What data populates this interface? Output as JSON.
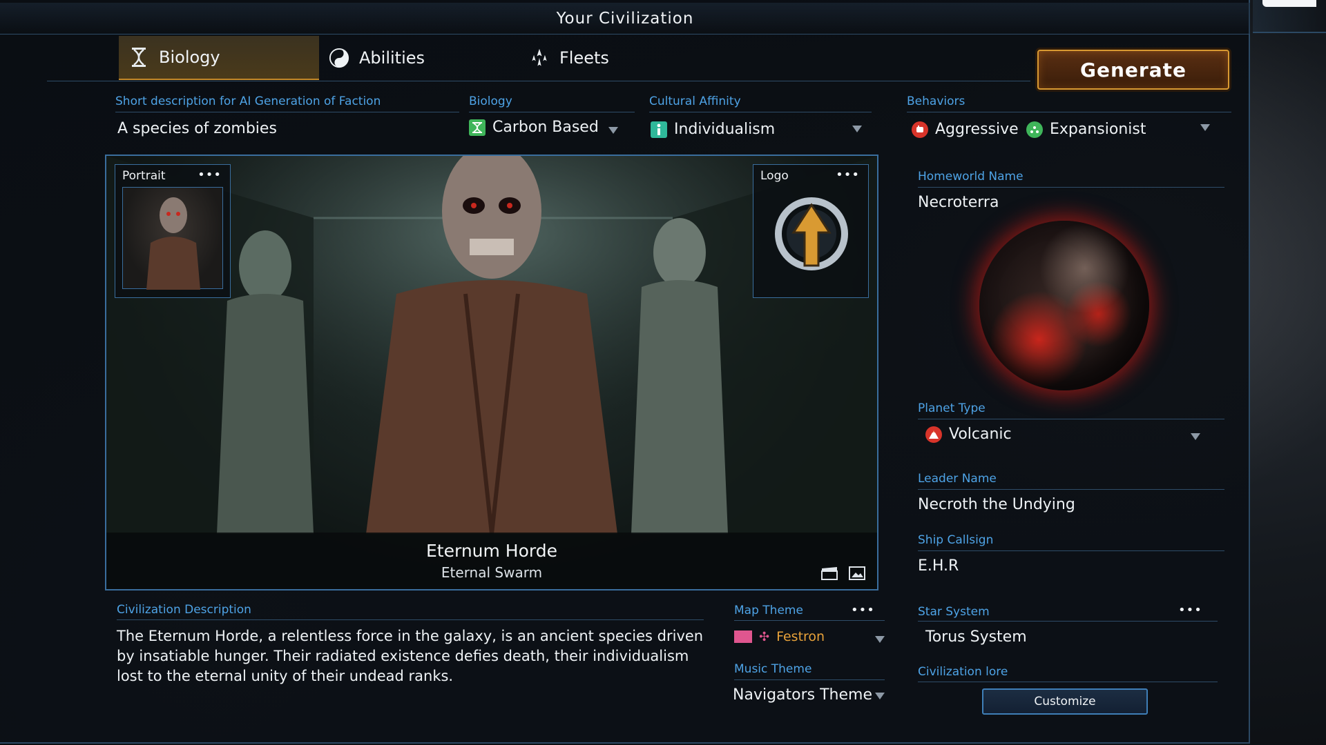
{
  "window": {
    "title": "Your Civilization"
  },
  "tabs": [
    {
      "label": "Biology",
      "icon": "dna-icon",
      "active": true
    },
    {
      "label": "Abilities",
      "icon": "yin-yang-icon",
      "active": false
    },
    {
      "label": "Fleets",
      "icon": "fleet-icon",
      "active": false
    }
  ],
  "generate": {
    "label": "Generate"
  },
  "description_field": {
    "label": "Short description for AI Generation of Faction",
    "value": "A species of zombies"
  },
  "biology": {
    "label": "Biology",
    "value": "Carbon Based",
    "color": "#3fb55a"
  },
  "cultural_affinity": {
    "label": "Cultural Affinity",
    "value": "Individualism",
    "color": "#2fb89a"
  },
  "behaviors": {
    "label": "Behaviors",
    "items": [
      {
        "label": "Aggressive",
        "color": "#d8342a"
      },
      {
        "label": "Expansionist",
        "color": "#3fb55a"
      }
    ]
  },
  "portrait": {
    "label": "Portrait",
    "menu": "•••"
  },
  "logo": {
    "label": "Logo",
    "menu": "•••"
  },
  "faction": {
    "name": "Eternum Horde",
    "subtitle": "Eternal Swarm"
  },
  "homeworld": {
    "label": "Homeworld Name",
    "value": "Necroterra"
  },
  "planet_type": {
    "label": "Planet Type",
    "value": "Volcanic",
    "color": "#d8342a"
  },
  "leader": {
    "label": "Leader Name",
    "value": "Necroth the Undying"
  },
  "ship_callsign": {
    "label": "Ship Callsign",
    "value": "E.H.R"
  },
  "civ_description": {
    "label": "Civilization Description",
    "value": "The Eternum Horde, a relentless force in the galaxy, is an ancient species driven by insatiable hunger. Their radiated existence defies death, their individualism lost to the eternal unity of their undead ranks."
  },
  "map_theme": {
    "label": "Map Theme",
    "value": "Festron",
    "menu": "•••",
    "color": "#e0568f",
    "value_color": "#e8a23a"
  },
  "music_theme": {
    "label": "Music Theme",
    "value": "Navigators Theme"
  },
  "star_system": {
    "label": "Star System",
    "value": "Torus System",
    "menu": "•••"
  },
  "civ_lore": {
    "label": "Civilization lore",
    "button": "Customize"
  }
}
